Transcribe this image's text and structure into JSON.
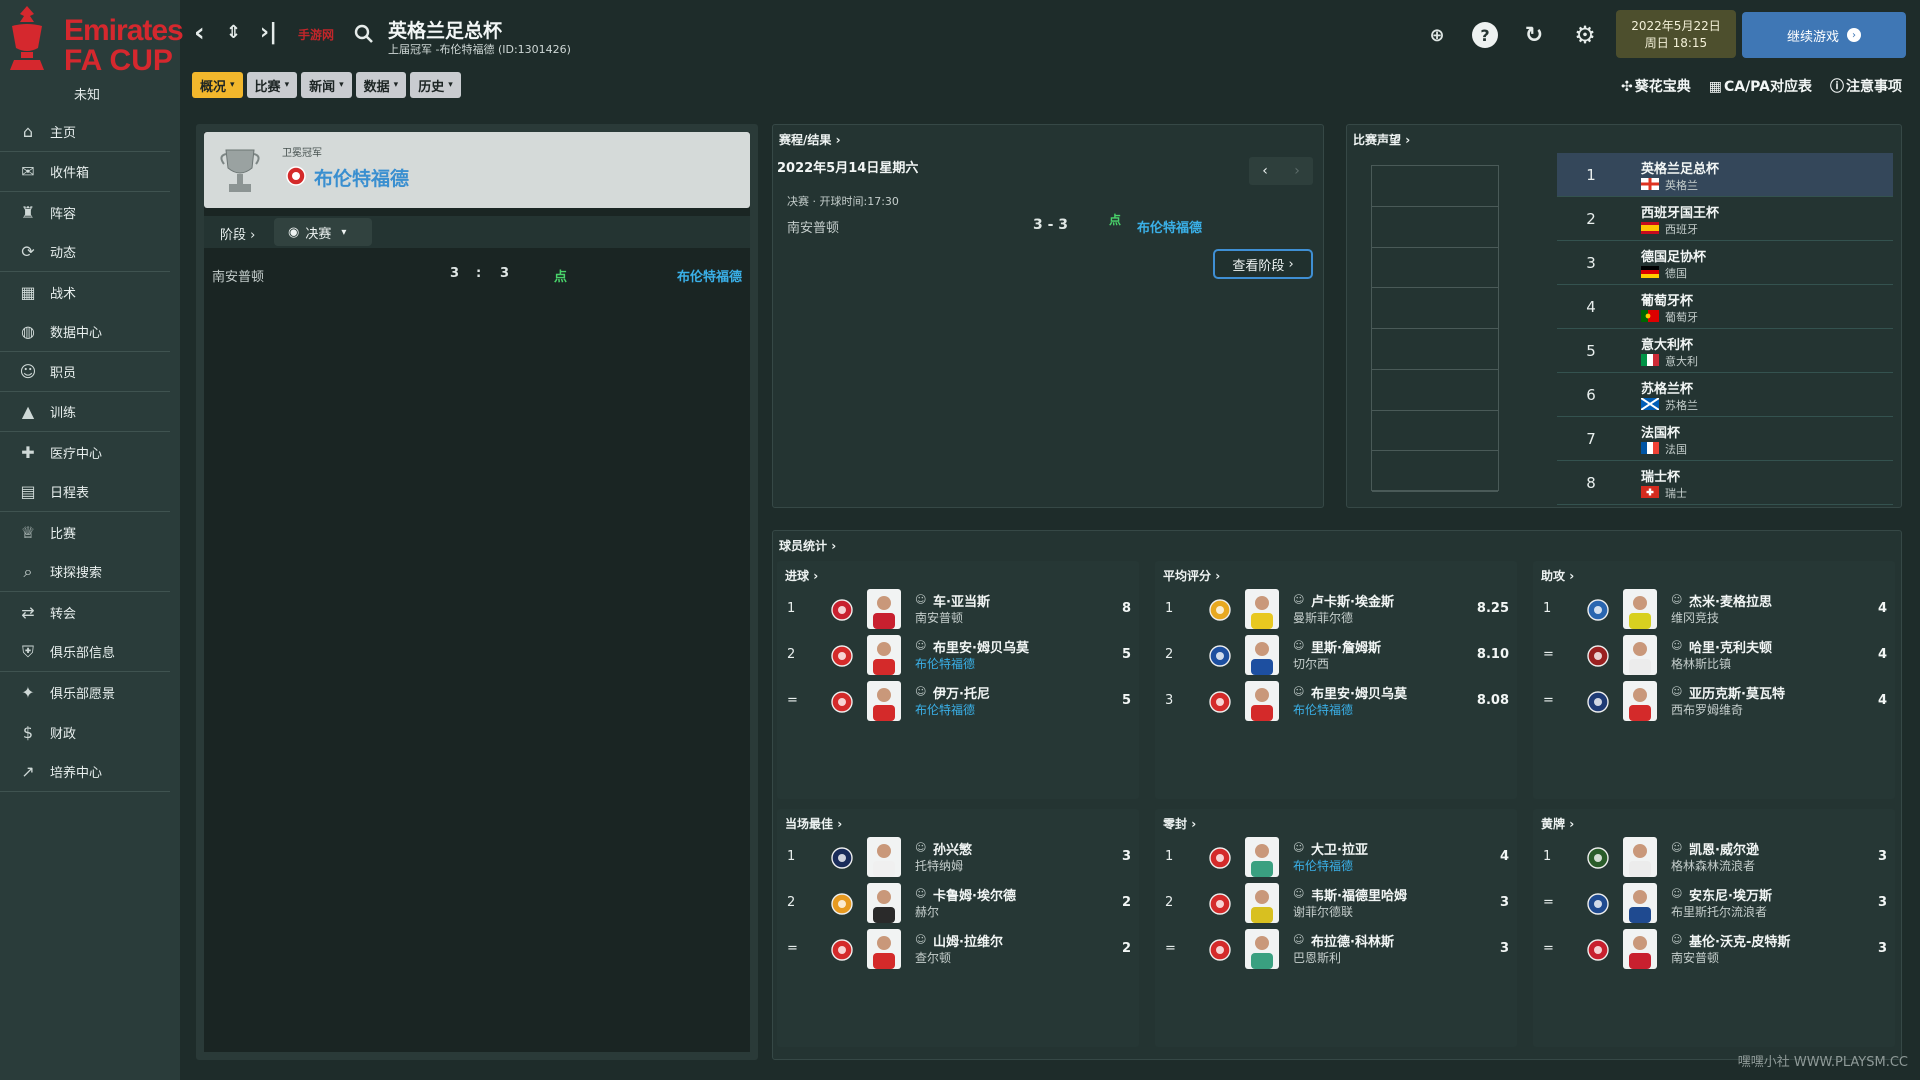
{
  "sidebar": {
    "logo_line1": "Emirates",
    "logo_line2": "FA CUP",
    "logo_sub": "未知",
    "items": [
      {
        "label": "主页",
        "icon": "home-icon"
      },
      {
        "label": "收件箱",
        "icon": "inbox-icon"
      },
      {
        "label": "阵容",
        "icon": "shirt-icon"
      },
      {
        "label": "动态",
        "icon": "dynamics-icon"
      },
      {
        "label": "战术",
        "icon": "tactics-icon"
      },
      {
        "label": "数据中心",
        "icon": "data-hub-icon"
      },
      {
        "label": "职员",
        "icon": "staff-icon"
      },
      {
        "label": "训练",
        "icon": "training-icon"
      },
      {
        "label": "医疗中心",
        "icon": "medical-icon"
      },
      {
        "label": "日程表",
        "icon": "calendar-icon"
      },
      {
        "label": "比赛",
        "icon": "trophy-icon"
      },
      {
        "label": "球探搜索",
        "icon": "scouting-icon"
      },
      {
        "label": "转会",
        "icon": "transfer-icon"
      },
      {
        "label": "俱乐部信息",
        "icon": "club-info-icon"
      },
      {
        "label": "俱乐部愿景",
        "icon": "club-vision-icon"
      },
      {
        "label": "财政",
        "icon": "finance-icon"
      },
      {
        "label": "培养中心",
        "icon": "development-icon"
      }
    ]
  },
  "header": {
    "title": "英格兰足总杯",
    "subtitle": "上届冠军 -布伦特福德 (ID:1301426)",
    "stamp": "手游网",
    "date_line1": "2022年5月22日",
    "date_line2": "周日 18:15",
    "continue_label": "继续游戏"
  },
  "menus": [
    "概况",
    "比赛",
    "新闻",
    "数据",
    "历史"
  ],
  "quick_links": [
    "葵花宝典",
    "CA/PA对应表",
    "注意事项"
  ],
  "left": {
    "winner_label": "卫冕冠军",
    "winner_name": "布伦特福德",
    "stage_label": "阶段",
    "stage_value": "决赛",
    "match": {
      "home": "南安普顿",
      "home_score": "3",
      "sep": ":",
      "away_score": "3",
      "pen": "点",
      "away": "布伦特福德"
    }
  },
  "fixtures": {
    "title": "赛程/结果",
    "date": "2022年5月14日星期六",
    "info": "决赛 · 开球时间:17:30",
    "home": "南安普顿",
    "score": "3 - 3",
    "pen": "点",
    "away": "布伦特福德",
    "view_stage": "查看阶段"
  },
  "reputation": {
    "title": "比赛声望",
    "rows": [
      {
        "rank": "1",
        "name": "英格兰足总杯",
        "country": "英格兰",
        "flag": "england"
      },
      {
        "rank": "2",
        "name": "西班牙国王杯",
        "country": "西班牙",
        "flag": "spain"
      },
      {
        "rank": "3",
        "name": "德国足协杯",
        "country": "德国",
        "flag": "germany"
      },
      {
        "rank": "4",
        "name": "葡萄牙杯",
        "country": "葡萄牙",
        "flag": "portugal"
      },
      {
        "rank": "5",
        "name": "意大利杯",
        "country": "意大利",
        "flag": "italy"
      },
      {
        "rank": "6",
        "name": "苏格兰杯",
        "country": "苏格兰",
        "flag": "scotland"
      },
      {
        "rank": "7",
        "name": "法国杯",
        "country": "法国",
        "flag": "france"
      },
      {
        "rank": "8",
        "name": "瑞士杯",
        "country": "瑞士",
        "flag": "switzerland"
      }
    ]
  },
  "stats": {
    "title": "球员统计",
    "blocks": [
      {
        "title": "进球",
        "rows": [
          {
            "rank": "1",
            "name": "车·亚当斯",
            "team": "南安普顿",
            "link": false,
            "value": "8",
            "club": "#c8202f",
            "shirt": "#c8202f"
          },
          {
            "rank": "2",
            "name": "布里安·姆贝乌莫",
            "team": "布伦特福德",
            "link": true,
            "value": "5",
            "club": "#d42a2a",
            "shirt": "#d42a2a"
          },
          {
            "rank": "=",
            "name": "伊万·托尼",
            "team": "布伦特福德",
            "link": true,
            "value": "5",
            "club": "#d42a2a",
            "shirt": "#d42a2a"
          }
        ]
      },
      {
        "title": "平均评分",
        "rows": [
          {
            "rank": "1",
            "name": "卢卡斯·埃金斯",
            "team": "曼斯菲尔德",
            "link": false,
            "value": "8.25",
            "club": "#e8a820",
            "shirt": "#e8c820"
          },
          {
            "rank": "2",
            "name": "里斯·詹姆斯",
            "team": "切尔西",
            "link": false,
            "value": "8.10",
            "club": "#1d4fa0",
            "shirt": "#1d4fa0"
          },
          {
            "rank": "3",
            "name": "布里安·姆贝乌莫",
            "team": "布伦特福德",
            "link": true,
            "value": "8.08",
            "club": "#d42a2a",
            "shirt": "#d42a2a"
          }
        ]
      },
      {
        "title": "助攻",
        "rows": [
          {
            "rank": "1",
            "name": "杰米·麦格拉思",
            "team": "维冈竞技",
            "link": false,
            "value": "4",
            "club": "#2a66b0",
            "shirt": "#d8d020"
          },
          {
            "rank": "=",
            "name": "哈里·克利夫顿",
            "team": "格林斯比镇",
            "link": false,
            "value": "4",
            "club": "#9a2020",
            "shirt": "#ececec"
          },
          {
            "rank": "=",
            "name": "亚历克斯·莫瓦特",
            "team": "西布罗姆维奇",
            "link": false,
            "value": "4",
            "club": "#1f3b75",
            "shirt": "#d42a2a"
          }
        ]
      },
      {
        "title": "当场最佳",
        "rows": [
          {
            "rank": "1",
            "name": "孙兴慜",
            "team": "托特纳姆",
            "link": false,
            "value": "3",
            "club": "#1a2c5a",
            "shirt": "#f0f0f0"
          },
          {
            "rank": "2",
            "name": "卡鲁姆·埃尔德",
            "team": "赫尔",
            "link": false,
            "value": "2",
            "club": "#e89a20",
            "shirt": "#2a2a2a"
          },
          {
            "rank": "=",
            "name": "山姆·拉维尔",
            "team": "查尔顿",
            "link": false,
            "value": "2",
            "club": "#d42a2a",
            "shirt": "#d42a2a"
          }
        ]
      },
      {
        "title": "零封",
        "rows": [
          {
            "rank": "1",
            "name": "大卫·拉亚",
            "team": "布伦特福德",
            "link": true,
            "value": "4",
            "club": "#d42a2a",
            "shirt": "#3aa080"
          },
          {
            "rank": "2",
            "name": "韦斯·福德里哈姆",
            "team": "谢菲尔德联",
            "link": false,
            "value": "3",
            "club": "#d42a2a",
            "shirt": "#d8c020"
          },
          {
            "rank": "=",
            "name": "布拉德·科林斯",
            "team": "巴恩斯利",
            "link": false,
            "value": "3",
            "club": "#d42a2a",
            "shirt": "#3aa080"
          }
        ]
      },
      {
        "title": "黄牌",
        "rows": [
          {
            "rank": "1",
            "name": "凯恩·威尔逊",
            "team": "格林森林流浪者",
            "link": false,
            "value": "3",
            "club": "#2a5c2a",
            "shirt": "#ececec"
          },
          {
            "rank": "=",
            "name": "安东尼·埃万斯",
            "team": "布里斯托尔流浪者",
            "link": false,
            "value": "3",
            "club": "#1f4a90",
            "shirt": "#1f4a90"
          },
          {
            "rank": "=",
            "name": "基伦·沃克-皮特斯",
            "team": "南安普顿",
            "link": false,
            "value": "3",
            "club": "#c8202f",
            "shirt": "#c8202f"
          }
        ]
      }
    ]
  },
  "watermark": "嘿嘿小社 WWW.PLAYSM.CC"
}
